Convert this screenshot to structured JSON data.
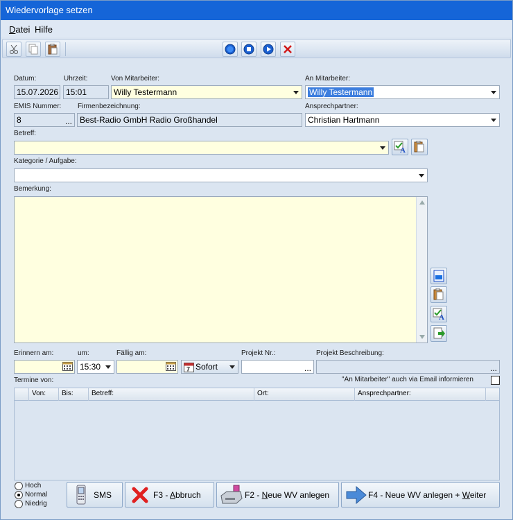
{
  "window": {
    "title": "Wiedervorlage setzen"
  },
  "menu": {
    "datei": "Datei",
    "hilfe": "Hilfe"
  },
  "fields": {
    "datum": {
      "label": "Datum:",
      "value": "15.07.2026"
    },
    "uhrzeit": {
      "label": "Uhrzeit:",
      "value": "15:01"
    },
    "von_mitarbeiter": {
      "label": "Von Mitarbeiter:",
      "value": "Willy Testermann"
    },
    "an_mitarbeiter": {
      "label": "An Mitarbeiter:",
      "value": "Willy Testermann"
    },
    "emis_nummer": {
      "label": "EMIS Nummer:",
      "value": "8",
      "dots": "..."
    },
    "firmenbezeichnung": {
      "label": "Firmenbezeichnung:",
      "value": "Best-Radio GmbH Radio Großhandel"
    },
    "ansprechpartner": {
      "label": "Ansprechpartner:",
      "value": "Christian Hartmann"
    },
    "betreff": {
      "label": "Betreff:",
      "value": ""
    },
    "kategorie": {
      "label": "Kategorie / Aufgabe:",
      "value": ""
    },
    "bemerkung": {
      "label": "Bemerkung:",
      "value": ""
    },
    "erinnern_am": {
      "label": "Erinnern am:",
      "value": ""
    },
    "um": {
      "label": "um:",
      "value": "15:30"
    },
    "faellig_am": {
      "label": "Fällig am:",
      "value": ""
    },
    "sofort": {
      "value": "Sofort"
    },
    "projekt_nr": {
      "label": "Projekt Nr.:",
      "value": "",
      "dots": "..."
    },
    "projekt_beschreibung": {
      "label": "Projekt Beschreibung:",
      "value": "",
      "dots": "..."
    },
    "termine_von": {
      "label": "Termine von:"
    },
    "email_info": {
      "label": "\"An Mitarbeiter\" auch via Email informieren",
      "checked": false
    }
  },
  "grid": {
    "columns": [
      "Von:",
      "Bis:",
      "Betreff:",
      "Ort:",
      "Ansprechpartner:"
    ],
    "rows": []
  },
  "priority": {
    "options": [
      "Hoch",
      "Normal",
      "Niedrig"
    ],
    "selected": "Normal"
  },
  "buttons": {
    "sms": "SMS",
    "abbruch_key": "F3 - ",
    "abbruch_u": "A",
    "abbruch_rest": "bbruch",
    "neu_key": "F2 - ",
    "neu_u": "N",
    "neu_rest": "eue WV anlegen",
    "weiter_prefix": "F4 - Neue WV anlegen + ",
    "weiter_u": "W",
    "weiter_rest": "eiter"
  },
  "colors": {
    "titlebar": "#1565d8",
    "window_bg": "#dbe5f1",
    "yellow_field": "#ffffe0",
    "selection": "#3d7ede"
  },
  "icons": [
    "scissors-icon",
    "copy-icon",
    "paste-icon",
    "record-icon",
    "stop-icon",
    "play-icon",
    "delete-icon",
    "spellcheck-icon",
    "clipboard-icon",
    "calendar-icon",
    "sms-phone-icon",
    "cancel-x-icon",
    "printer-icon",
    "arrow-right-icon"
  ]
}
